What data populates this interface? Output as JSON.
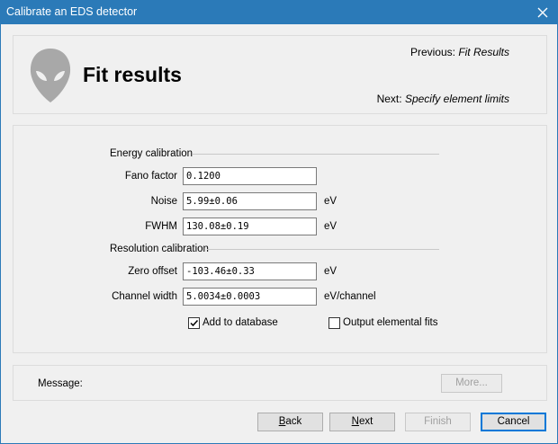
{
  "window": {
    "title": "Calibrate an EDS detector"
  },
  "header": {
    "page_title": "Fit results",
    "previous_prefix": "Previous:",
    "previous_value": "Fit Results",
    "next_prefix": "Next:",
    "next_value": "Specify element limits",
    "logo_icon": "alien-head-icon"
  },
  "energy_calibration": {
    "heading": "Energy calibration",
    "fields": [
      {
        "label": "Fano factor",
        "value": "0.1200",
        "unit": ""
      },
      {
        "label": "Noise",
        "value": "5.99±0.06",
        "unit": "eV"
      },
      {
        "label": "FWHM",
        "value": "130.08±0.19",
        "unit": "eV"
      }
    ]
  },
  "resolution_calibration": {
    "heading": "Resolution calibration",
    "fields": [
      {
        "label": "Zero offset",
        "value": "-103.46±0.33",
        "unit": "eV"
      },
      {
        "label": "Channel width",
        "value": "5.0034±0.0003",
        "unit": "eV/channel"
      }
    ]
  },
  "options": {
    "add_to_database": {
      "label": "Add to database",
      "checked": true
    },
    "output_elemental_fits": {
      "label": "Output elemental fits",
      "checked": false
    }
  },
  "message": {
    "label": "Message:",
    "more_button": "More..."
  },
  "buttons": {
    "back_u": "B",
    "back_rest": "ack",
    "next_u": "N",
    "next_rest": "ext",
    "finish": "Finish",
    "cancel": "Cancel"
  },
  "colors": {
    "titlebar": "#2b7ab8",
    "panel_border": "#dcdcdc",
    "default_button_border": "#0078d7"
  }
}
